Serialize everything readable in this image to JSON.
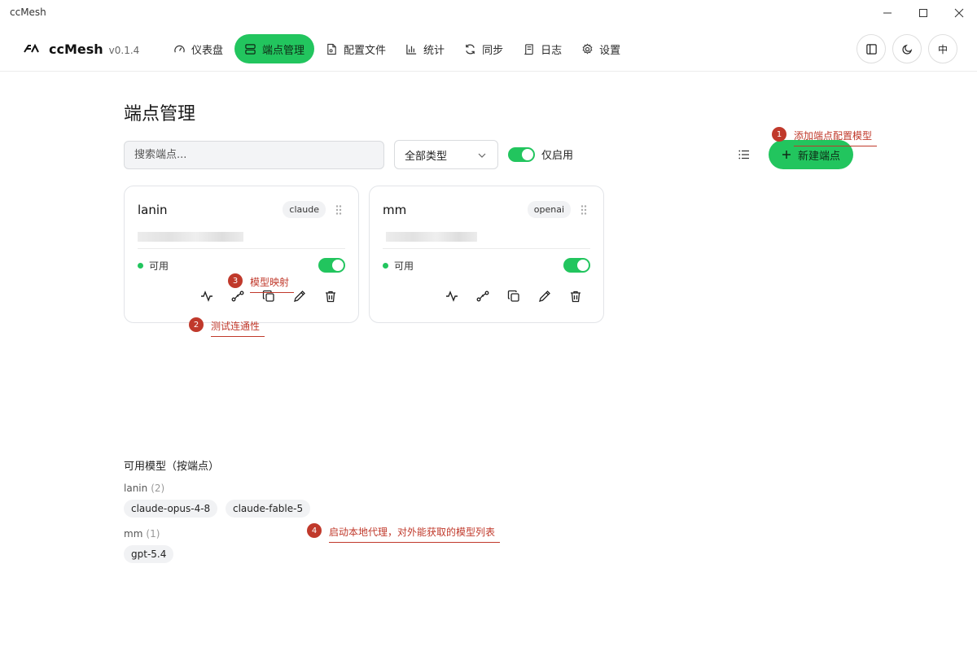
{
  "window": {
    "title": "ccMesh"
  },
  "app": {
    "name": "ccMesh",
    "version": "v0.1.4"
  },
  "nav": {
    "items": [
      {
        "label": "仪表盘",
        "icon": "gauge-icon"
      },
      {
        "label": "端点管理",
        "icon": "server-icon",
        "active": true
      },
      {
        "label": "配置文件",
        "icon": "file-icon"
      },
      {
        "label": "统计",
        "icon": "bar-chart-icon"
      },
      {
        "label": "同步",
        "icon": "sync-icon"
      },
      {
        "label": "日志",
        "icon": "scroll-icon"
      },
      {
        "label": "设置",
        "icon": "gear-icon"
      }
    ]
  },
  "header_buttons": {
    "language": "中"
  },
  "page": {
    "title": "端点管理"
  },
  "toolbar": {
    "search_placeholder": "搜索端点...",
    "type_filter": "全部类型",
    "enabled_only_label": "仅启用",
    "enabled_only": true,
    "new_button": "新建端点"
  },
  "endpoints": [
    {
      "name": "lanin",
      "type": "claude",
      "status": "可用",
      "enabled": true
    },
    {
      "name": "mm",
      "type": "openai",
      "status": "可用",
      "enabled": true
    }
  ],
  "annotations": [
    {
      "num": "1",
      "text": "添加端点配置模型"
    },
    {
      "num": "2",
      "text": "测试连通性"
    },
    {
      "num": "3",
      "text": "模型映射"
    },
    {
      "num": "4",
      "text": "启动本地代理，对外能获取的模型列表"
    }
  ],
  "models": {
    "title": "可用模型（按端点）",
    "groups": [
      {
        "endpoint": "lanin",
        "count": "(2)",
        "models": [
          "claude-opus-4-8",
          "claude-fable-5"
        ]
      },
      {
        "endpoint": "mm",
        "count": "(1)",
        "models": [
          "gpt-5.4"
        ]
      }
    ]
  },
  "colors": {
    "accent": "#22c55e",
    "annotation": "#c0392b"
  }
}
